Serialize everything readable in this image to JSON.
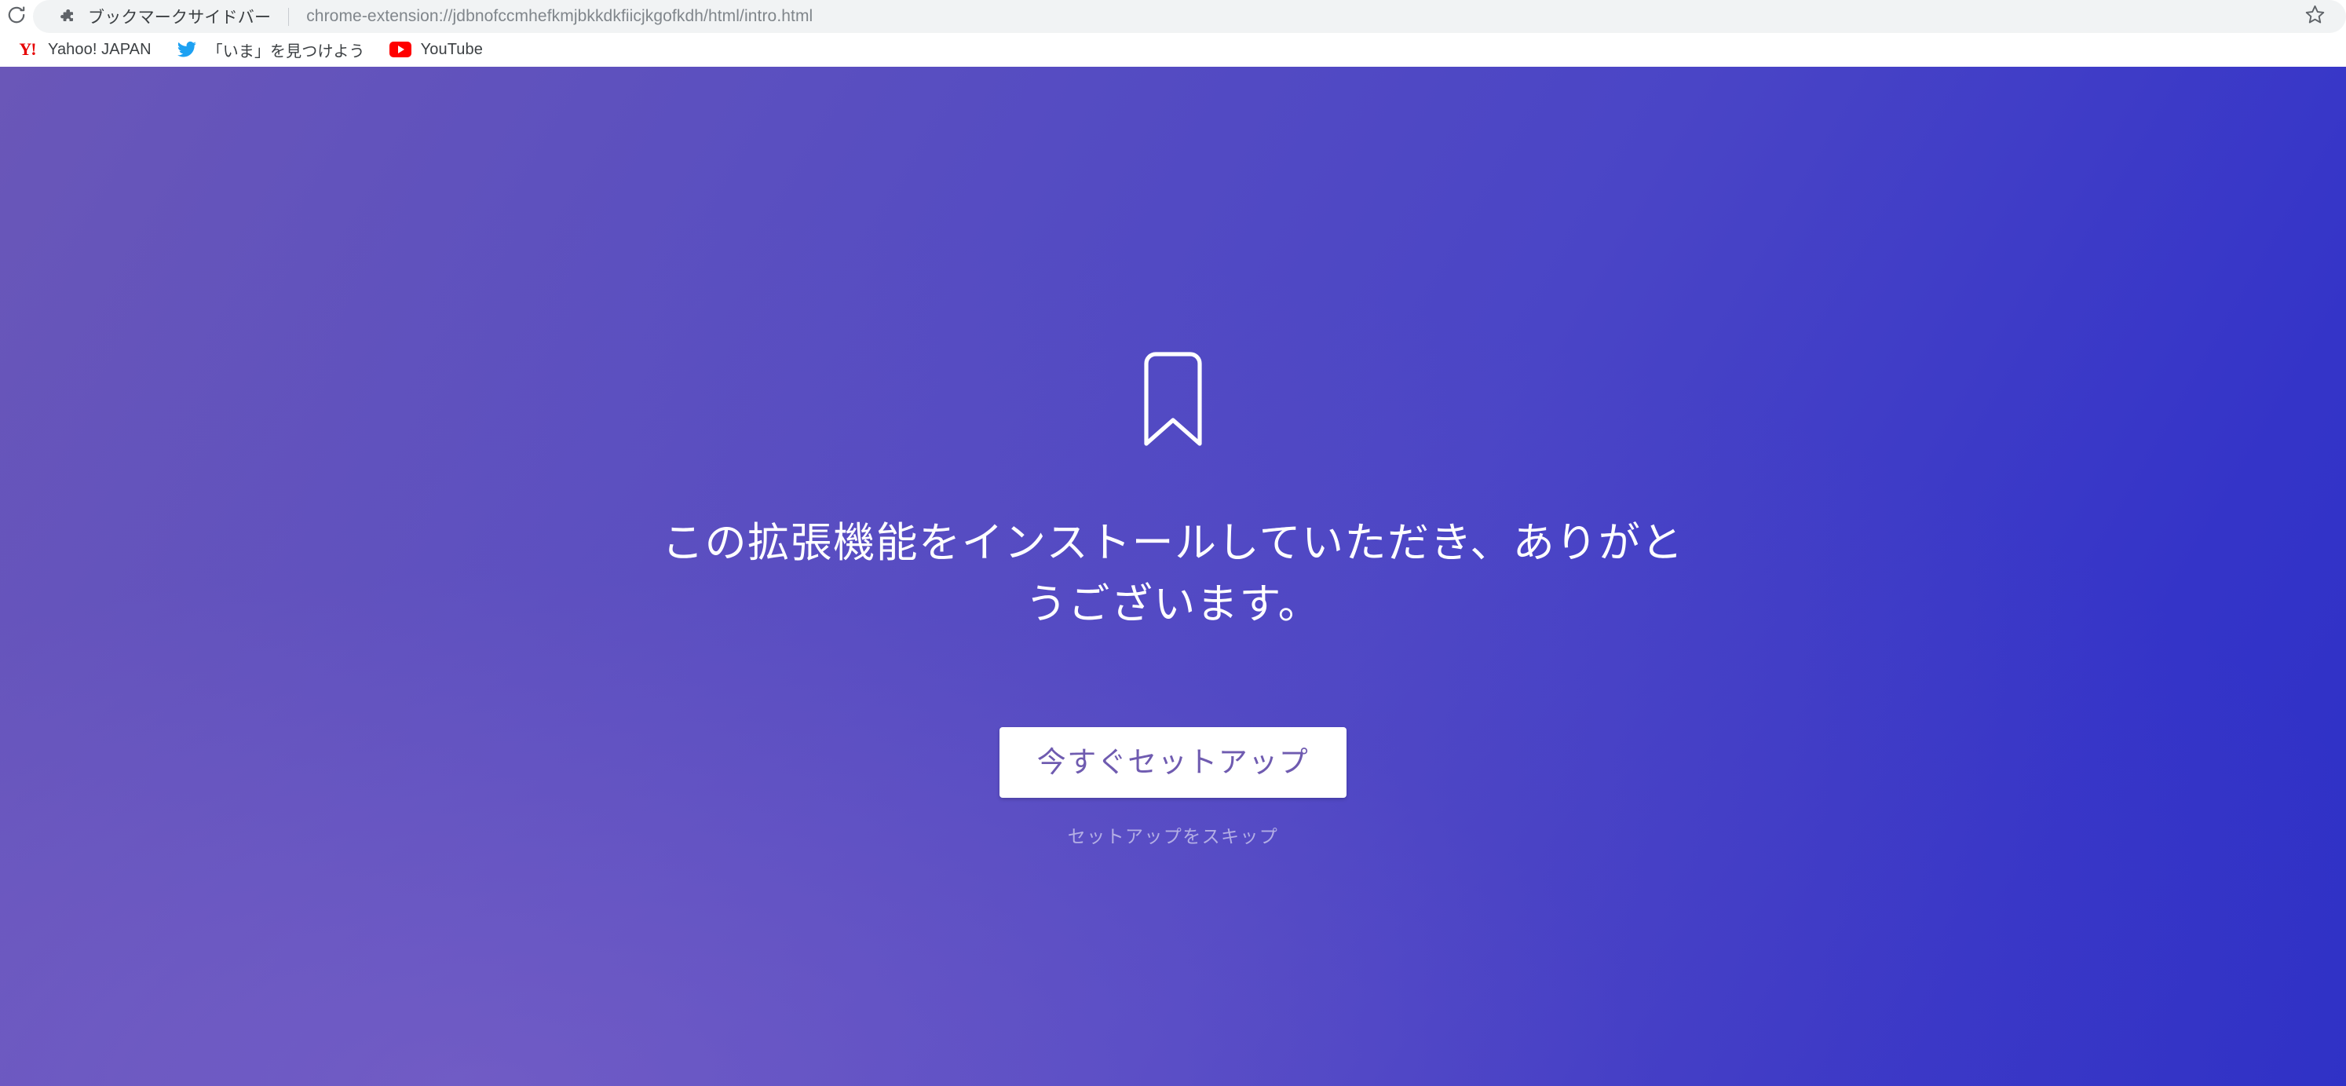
{
  "browser": {
    "reload_icon": "reload-icon",
    "omnibox": {
      "extension_icon": "puzzle-piece-icon",
      "extension_name": "ブックマークサイドバー",
      "url": "chrome-extension://jdbnofccmhefkmjbkkdkfiicjkgofkdh/html/intro.html"
    },
    "star_icon": "star-outline-icon",
    "bookmarks": [
      {
        "icon": "yahoo-japan-icon",
        "icon_text": "Y!",
        "label": "Yahoo! JAPAN"
      },
      {
        "icon": "twitter-bird-icon",
        "label": "「いま」を見つけよう"
      },
      {
        "icon": "youtube-icon",
        "label": "YouTube"
      }
    ]
  },
  "page": {
    "logo_icon": "bookmark-outline-icon",
    "headline": "この拡張機能をインストールしていただき、ありがとうございます。",
    "primary_button": "今すぐセットアップ",
    "skip_link": "セットアップをスキップ",
    "colors": {
      "gradient_top_left": "#5b50b5",
      "gradient_top_right": "#2e32c4",
      "gradient_bottom_left": "#7059b4",
      "gradient_bottom_right": "#4040c4",
      "button_text": "#6f5bb0",
      "button_background": "#ffffff"
    }
  }
}
